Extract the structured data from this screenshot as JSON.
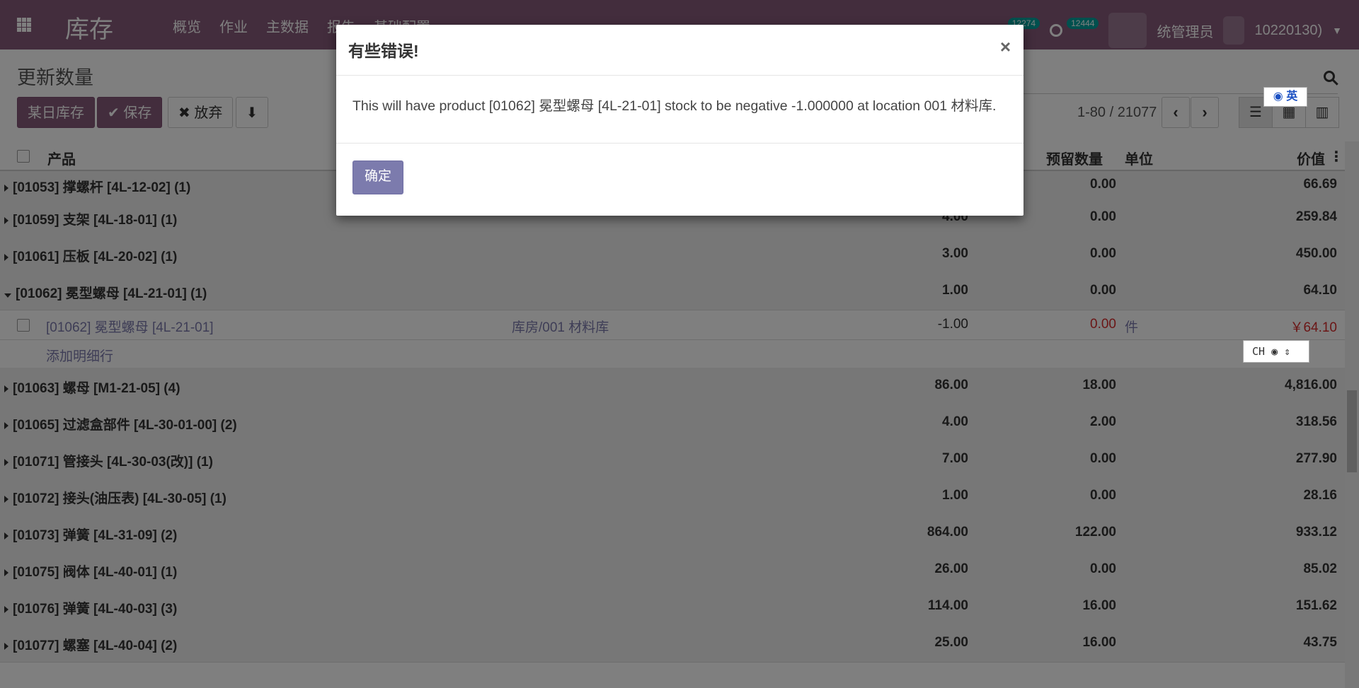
{
  "nav": {
    "app_name": "库存",
    "menu": [
      "概览",
      "作业",
      "主数据",
      "报告",
      "基础配置"
    ],
    "badge1": "12274",
    "badge2": "12444",
    "user": "统管理员",
    "user_id": "10220130)"
  },
  "control": {
    "title": "更新数量",
    "btn_inventory_date": "某日库存",
    "btn_save": "保存",
    "btn_discard": "放弃",
    "pager": "1-80 / 21077"
  },
  "table": {
    "headers": {
      "product": "产品",
      "reserved": "预留数量",
      "unit": "单位",
      "value": "价值"
    },
    "rows": [
      {
        "type": "group",
        "name": "[01053] 撑螺杆 [4L-12-02] (1)",
        "qty": "",
        "reserved": "0.00",
        "value": "66.69"
      },
      {
        "type": "group",
        "name": "[01059] 支架 [4L-18-01] (1)",
        "qty": "4.00",
        "reserved": "0.00",
        "value": "259.84"
      },
      {
        "type": "group",
        "name": "[01061] 压板 [4L-20-02] (1)",
        "qty": "3.00",
        "reserved": "0.00",
        "value": "450.00"
      },
      {
        "type": "group-open",
        "name": "[01062] 冕型螺母 [4L-21-01] (1)",
        "qty": "1.00",
        "reserved": "0.00",
        "value": "64.10"
      },
      {
        "type": "record",
        "name": "[01062] 冕型螺母 [4L-21-01]",
        "location": "库房/001 材料库",
        "qty": "-1.00",
        "reserved": "0.00",
        "unit": "件",
        "value": "￥64.10"
      },
      {
        "type": "add",
        "name": "添加明细行"
      },
      {
        "type": "group",
        "name": "[01063] 螺母 [M1-21-05] (4)",
        "qty": "86.00",
        "reserved": "18.00",
        "value": "4,816.00"
      },
      {
        "type": "group",
        "name": "[01065] 过滤盒部件 [4L-30-01-00] (2)",
        "qty": "4.00",
        "reserved": "2.00",
        "value": "318.56"
      },
      {
        "type": "group",
        "name": "[01071] 管接头 [4L-30-03(改)] (1)",
        "qty": "7.00",
        "reserved": "0.00",
        "value": "277.90"
      },
      {
        "type": "group",
        "name": "[01072] 接头(油压表) [4L-30-05] (1)",
        "qty": "1.00",
        "reserved": "0.00",
        "value": "28.16"
      },
      {
        "type": "group",
        "name": "[01073] 弹簧 [4L-31-09] (2)",
        "qty": "864.00",
        "reserved": "122.00",
        "value": "933.12"
      },
      {
        "type": "group",
        "name": "[01075] 阀体 [4L-40-01] (1)",
        "qty": "26.00",
        "reserved": "0.00",
        "value": "85.02"
      },
      {
        "type": "group",
        "name": "[01076] 弹簧 [4L-40-03] (3)",
        "qty": "114.00",
        "reserved": "16.00",
        "value": "151.62"
      },
      {
        "type": "group",
        "name": "[01077] 螺塞 [4L-40-04] (2)",
        "qty": "25.00",
        "reserved": "16.00",
        "value": "43.75"
      }
    ]
  },
  "modal": {
    "title": "有些错误!",
    "close": "×",
    "message": "This will have product [01062] 冕型螺母 [4L-21-01] stock to be negative -1.000000 at location 001 材料库.",
    "ok": "确定"
  },
  "ime": {
    "lang_label": "英",
    "bar_label": "CH"
  },
  "colors": {
    "nav": "#875a7b",
    "primary": "#875a7b",
    "link": "#7c7bad",
    "negative": "#d62d2d",
    "badge": "#00a09d"
  }
}
